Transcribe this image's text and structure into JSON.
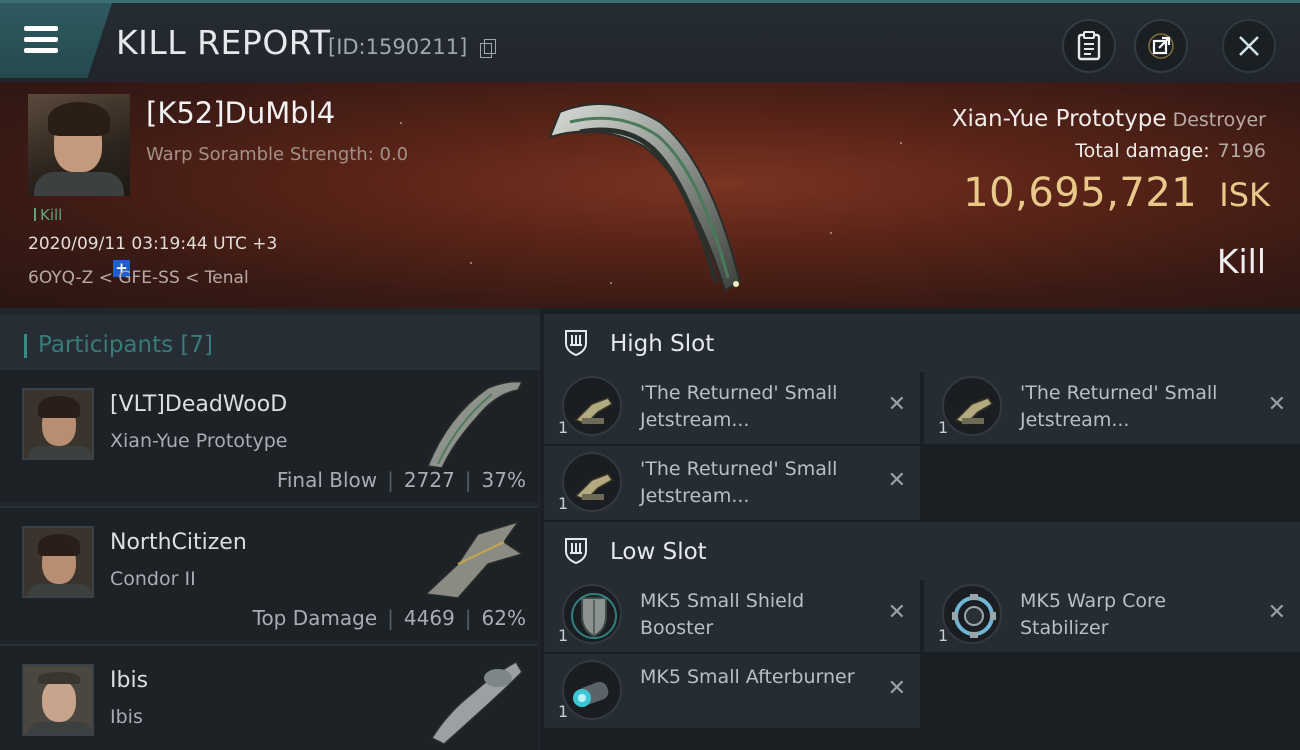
{
  "header": {
    "title": "KILL REPORT",
    "report_id": "[ID:1590211]"
  },
  "victim": {
    "name": "[K52]DuMbl4",
    "warp_scramble": "Warp Soramble Strength: 0.0",
    "tag": "Kill",
    "time": "2020/09/11 03:19:44 UTC +3",
    "location": "6OYQ-Z < GFE-SS < Tenal",
    "ship_name": "Xian-Yue Prototype",
    "ship_class": "Destroyer",
    "total_damage_label": "Total damage:",
    "total_damage_value": "7196",
    "isk_value": "10,695,721",
    "isk_unit": "ISK",
    "result": "Kill"
  },
  "participants": {
    "title": "Participants [7]",
    "rows": [
      {
        "name": "[VLT]DeadWooD",
        "ship": "Xian-Yue Prototype",
        "role": "Final Blow",
        "damage": "2727",
        "percent": "37%"
      },
      {
        "name": "NorthCitizen",
        "ship": "Condor II",
        "role": "Top Damage",
        "damage": "4469",
        "percent": "62%"
      },
      {
        "name": "Ibis",
        "ship": "Ibis",
        "role": "",
        "damage": "",
        "percent": ""
      }
    ]
  },
  "fittings": {
    "high_slot_title": "High Slot",
    "low_slot_title": "Low Slot",
    "high": [
      {
        "name": "'The Returned' Small Jetstream...",
        "qty": "1"
      },
      {
        "name": "'The Returned' Small Jetstream...",
        "qty": "1"
      },
      {
        "name": "'The Returned' Small Jetstream...",
        "qty": "1"
      }
    ],
    "low": [
      {
        "name": "MK5 Small Shield Booster",
        "qty": "1"
      },
      {
        "name": "MK5 Warp Core Stabilizer",
        "qty": "1"
      },
      {
        "name": "MK5 Small Afterburner",
        "qty": "1"
      }
    ],
    "remove_glyph": "✕"
  },
  "colors": {
    "accent": "#3a8a86",
    "isk": "#e8c98a",
    "kill_tag": "#5ea37f"
  }
}
